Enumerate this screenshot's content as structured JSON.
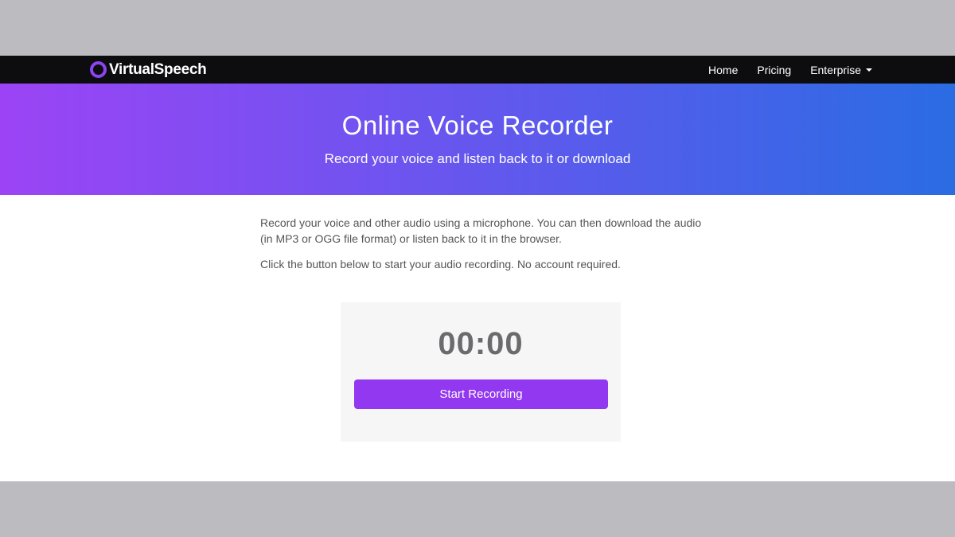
{
  "brand": {
    "name": "VirtualSpeech",
    "accent_color": "#8a44f0"
  },
  "nav": {
    "items": [
      {
        "label": "Home"
      },
      {
        "label": "Pricing"
      },
      {
        "label": "Enterprise",
        "has_dropdown": true
      }
    ]
  },
  "hero": {
    "title": "Online Voice Recorder",
    "subtitle": "Record your voice and listen back to it or download",
    "gradient": [
      "#9c44f5",
      "#6a55ef",
      "#2a6ce3"
    ]
  },
  "intro": {
    "paragraph1": "Record your voice and other audio using a microphone. You can then download the audio (in MP3 or OGG file format) or listen back to it in the browser.",
    "paragraph2": "Click the button below to start your audio recording. No account required."
  },
  "recorder": {
    "timer": "00:00",
    "start_label": "Start Recording",
    "button_color": "#9238f0"
  }
}
